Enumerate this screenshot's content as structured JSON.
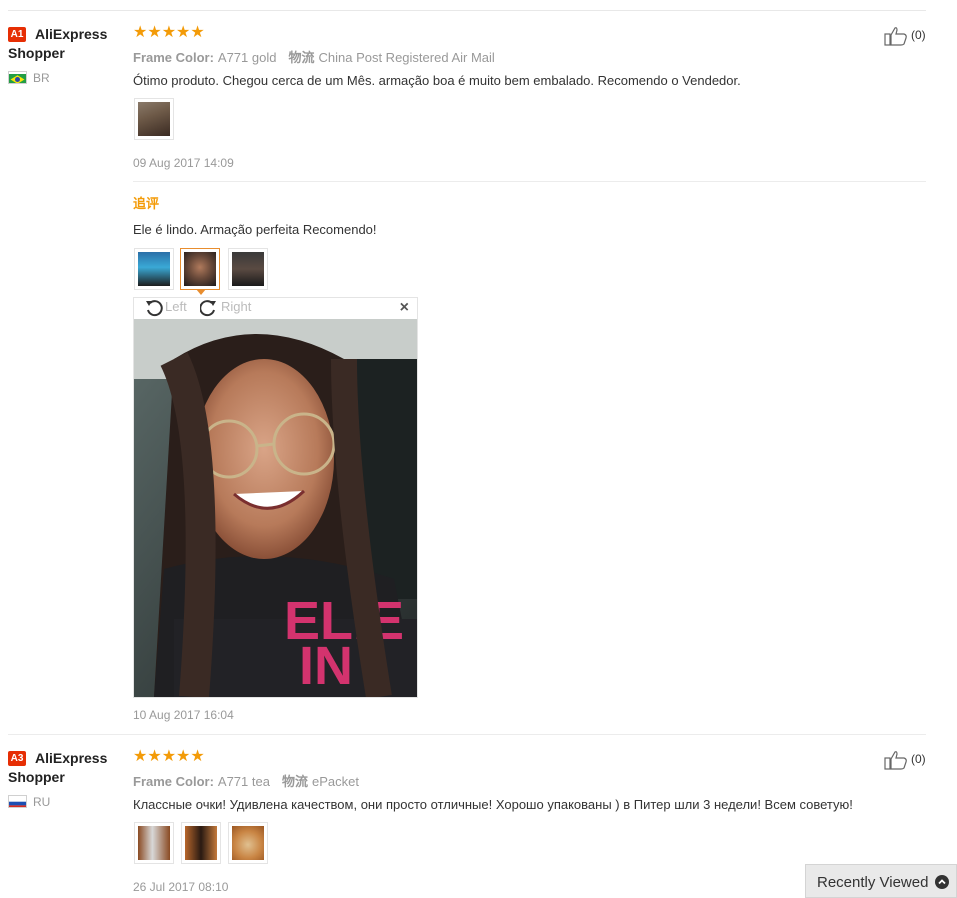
{
  "reviews": [
    {
      "badge": "A1",
      "buyer": "AliExpress Shopper",
      "country": "BR",
      "stars": "★★★★★",
      "frame_label": "Frame Color:",
      "frame_value": "A771 gold",
      "ship_label": "物流",
      "ship_value": "China Post Registered Air Mail",
      "text": "Ótimo produto. Chegou cerca de um Mês. armação boa é muito bem embalado. Recomendo o Vendedor.",
      "date": "09 Aug 2017 14:09",
      "likes": "(0)",
      "followup": {
        "label": "追评",
        "text": "Ele é lindo. Armação perfeita Recomendo!",
        "date": "10 Aug 2017 16:04"
      }
    },
    {
      "badge": "A3",
      "buyer": "AliExpress Shopper",
      "country": "RU",
      "stars": "★★★★★",
      "frame_label": "Frame Color:",
      "frame_value": "A771 tea",
      "ship_label": "物流",
      "ship_value": "ePacket",
      "text": "Классные очки! Удивлена качеством, они просто отличные! Хорошо упакованы ) в Питер шли 3 недели! Всем советую!",
      "date": "26 Jul 2017 08:10",
      "likes": "(0)"
    }
  ],
  "viewer": {
    "rotate_left": "Left",
    "rotate_right": "Right",
    "close": "×"
  },
  "recently_viewed": "Recently Viewed",
  "colors": {
    "badge": "#e62e04",
    "stars": "#f39b08",
    "followup": "#f39b08",
    "active_thumb": "#e88d2e"
  }
}
